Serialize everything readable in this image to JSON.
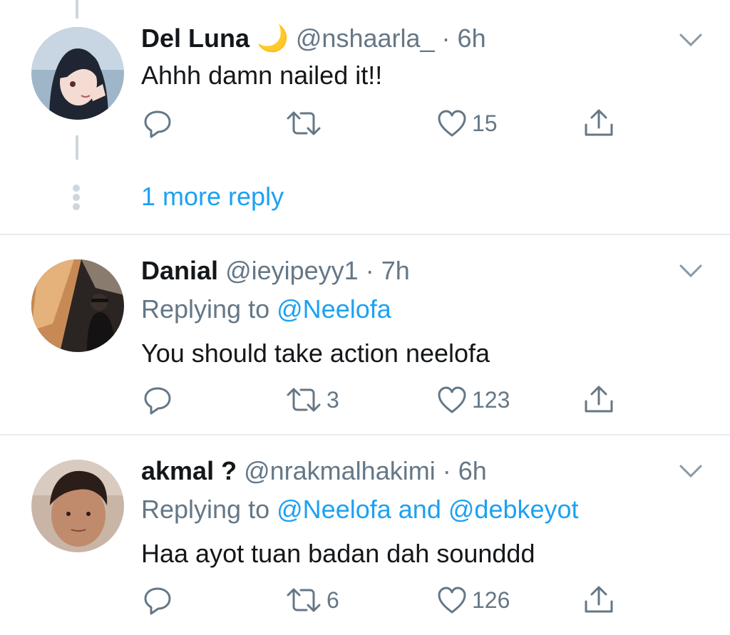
{
  "thread": {
    "more_reply_label": "1 more reply"
  },
  "tweets": [
    {
      "display_name": "Del Luna",
      "name_emoji": "🌙",
      "handle": "@nshaarla_",
      "time": "6h",
      "replying_to_label": "",
      "replying_to": [],
      "text": "Ahhh damn nailed it!!",
      "retweets": "",
      "likes": "15",
      "avatar_color": "#3a4a6b"
    },
    {
      "display_name": "Danial",
      "name_emoji": "",
      "handle": "@ieyipeyy1",
      "time": "7h",
      "replying_to_label": "Replying to",
      "replying_to": [
        "@Neelofa"
      ],
      "text": "You should take action neelofa",
      "retweets": "3",
      "likes": "123",
      "avatar_color": "#6b4a2e"
    },
    {
      "display_name": "akmal ?",
      "name_emoji": "",
      "handle": "@nrakmalhakimi",
      "time": "6h",
      "replying_to_label": "Replying to",
      "replying_to": [
        "@Neelofa",
        "and",
        "@debkeyot"
      ],
      "text": "Haa ayot tuan badan dah sounddd",
      "retweets": "6",
      "likes": "126",
      "avatar_color": "#b08a73"
    }
  ],
  "icons": {
    "reply": "reply-icon",
    "retweet": "retweet-icon",
    "like": "like-icon",
    "share": "share-icon",
    "caret": "chevron-down-icon"
  },
  "colors": {
    "link": "#1da1f2",
    "muted": "#657786",
    "text": "#14171a",
    "divider": "#e6ecf0"
  }
}
